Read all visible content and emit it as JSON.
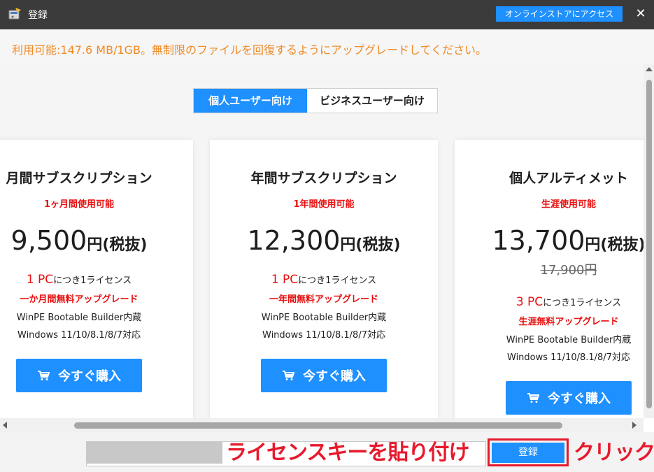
{
  "window": {
    "title": "登録",
    "store_button": "オンラインストアにアクセス",
    "close_glyph": "✕"
  },
  "notice": "利用可能:147.6 MB/1GB。無制限のファイルを回復するようにアップグレードしてください。",
  "tabs": [
    {
      "label": "個人ユーザー向け",
      "active": true
    },
    {
      "label": "ビジネスユーザー向け",
      "active": false
    }
  ],
  "plans": [
    {
      "title": "月間サブスクリプション",
      "subtitle": "1ヶ月間使用可能",
      "price": "9,500",
      "price_unit": "円(税抜)",
      "pc_count": "1 PC",
      "license_text": "につき1ライセンス",
      "upgrade": "一か月間無料アップグレード",
      "feature1": "WinPE Bootable Builder内蔵",
      "feature2": "Windows 11/10/8.1/8/7対応",
      "buy_label": "今すぐ購入"
    },
    {
      "title": "年間サブスクリプション",
      "subtitle": "1年間使用可能",
      "price": "12,300",
      "price_unit": "円(税抜)",
      "pc_count": "1 PC",
      "license_text": "につき1ライセンス",
      "upgrade": "一年間無料アップグレード",
      "feature1": "WinPE Bootable Builder内蔵",
      "feature2": "Windows 11/10/8.1/8/7対応",
      "buy_label": "今すぐ購入"
    },
    {
      "title": "個人アルティメット",
      "subtitle": "生涯使用可能",
      "price": "13,700",
      "price_unit": "円(税抜)",
      "original_price": "17,900円",
      "pc_count": "3 PC",
      "license_text": "につき1ライセンス",
      "upgrade": "生涯無料アップグレード",
      "feature1": "WinPE Bootable Builder内蔵",
      "feature2": "Windows 11/10/8.1/8/7対応",
      "buy_label": "今すぐ購入"
    }
  ],
  "footer": {
    "key_placeholder": "",
    "key_annotation": "ライセンスキーを貼り付け",
    "register_label": "登録",
    "click_annotation": "クリック"
  },
  "colors": {
    "accent": "#1e90ff",
    "notice": "#f08a26",
    "highlight": "#e81010",
    "annotation": "#e8192c"
  },
  "icons": [
    "app-icon",
    "close-icon",
    "cart-icon",
    "scroll-arrow-icon"
  ]
}
